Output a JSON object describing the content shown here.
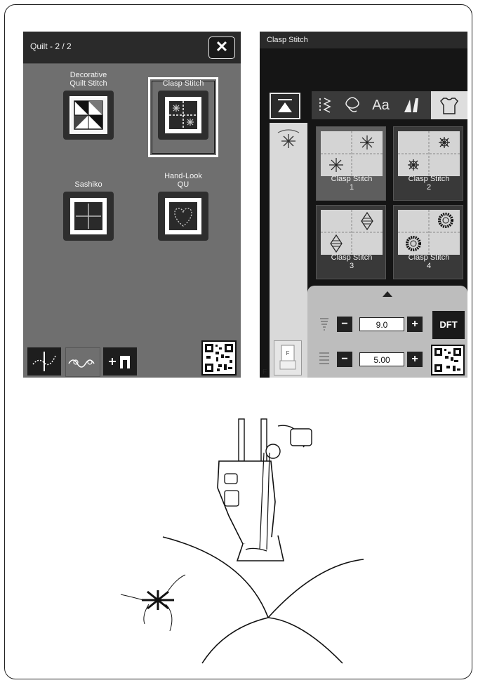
{
  "left_screen": {
    "title": "Quilt - 2 / 2",
    "close_label": "✕",
    "options": [
      {
        "label": "Decorative\nQuilt Stitch"
      },
      {
        "label": "Clasp Stitch"
      },
      {
        "label": "Sashiko"
      },
      {
        "label": "Hand-Look\nQU"
      }
    ],
    "bottom_tabs": [
      "quilt-stitch-icon",
      "decorative-stitch-icon",
      "add-foot-icon"
    ],
    "selected_option": "Clasp Stitch"
  },
  "right_screen": {
    "title": "Clasp Stitch",
    "category_tabs": [
      "utility-stitch-icon",
      "decorative-icon",
      "Aa",
      "satin-icon",
      "shirt-icon"
    ],
    "patterns": [
      {
        "label": "Clasp Stitch\n1"
      },
      {
        "label": "Clasp Stitch\n2"
      },
      {
        "label": "Clasp Stitch\n3"
      },
      {
        "label": "Clasp Stitch\n4"
      }
    ],
    "stitch_width": "9.0",
    "stitch_length": "5.00",
    "minus_label": "−",
    "plus_label": "+",
    "dft_label": "DFT",
    "foot_letter": "F",
    "foot_tile_letter": "F"
  }
}
